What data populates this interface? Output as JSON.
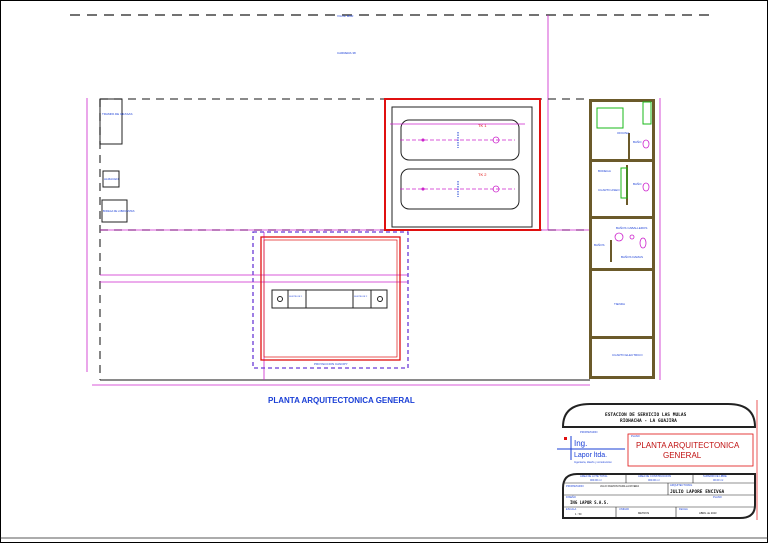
{
  "drawing": {
    "title": "PLANTA ARQUITECTONICA GENERAL",
    "street_top": "VIA AL MAR",
    "street_second": "CARRERA 38",
    "site_labels": {
      "grease_trap": "TRAMPA DE GRASAS",
      "storage": "ALMACEN",
      "lubricants": "BODEGA DE LUBRICANTES",
      "canopy": "PROYECCION CANOPY",
      "tank1": "TK 1",
      "tank2": "TK 2",
      "dispenser_left": "SURTIDOR 1",
      "dispenser_right": "SURTIDOR 2"
    },
    "rooms": {
      "office": "OFICINA",
      "bath1": "BAÑO",
      "cellar": "BODEGA",
      "cleaning": "CUARTO ASEO",
      "bath2": "BAÑO",
      "baths": "BAÑOS",
      "men": "BAÑOS CABALLEROS",
      "women": "BAÑOS DAMAS",
      "shop": "TIENDA",
      "electrical": "CUARTO ELECTRICO"
    }
  },
  "title_block": {
    "project_line1": "ESTACION DE SERVICIO LAS MULAS",
    "project_line2": "RIOHACHA - LA GUAJIRA",
    "owner_caption": "PROPIETARIO",
    "logo_line1": "Ing.",
    "logo_line2": "Lapor ltda.",
    "logo_sub": "Ingenieria, diseño y construccion",
    "plan_caption": "PLANO",
    "plan_line1": "PLANTA ARQUITECTONICA",
    "plan_line2": "GENERAL",
    "lot_area_label": "AREA DE LOTE TOTAL",
    "lot_area_value": "000.00 m²",
    "built_area_label": "AREA DE CONSTRUCCION",
    "built_area_value": "000.00 m²",
    "free_area_label": "SUPERFICIE LIBRE",
    "free_area_value": "00.00 m²",
    "owner_label": "PROPIETARIO:",
    "owner_value": "JULIO RAMON PADILLA RIVERA",
    "designer_label": "ARQUITECTO/ING",
    "designer_value": "JULIO LAPORE ENCIVGA",
    "design_label": "DISEÑO",
    "design_value": "ING LAPOR S.A.S.",
    "sheet_label": "PLANO",
    "scale_label": "ESCALA",
    "scale_value": "1 : 50",
    "unit_label": "UNIDAD",
    "unit_value": "METROS",
    "date_label": "FECHA",
    "date_value": "ABRIL de 2023"
  }
}
